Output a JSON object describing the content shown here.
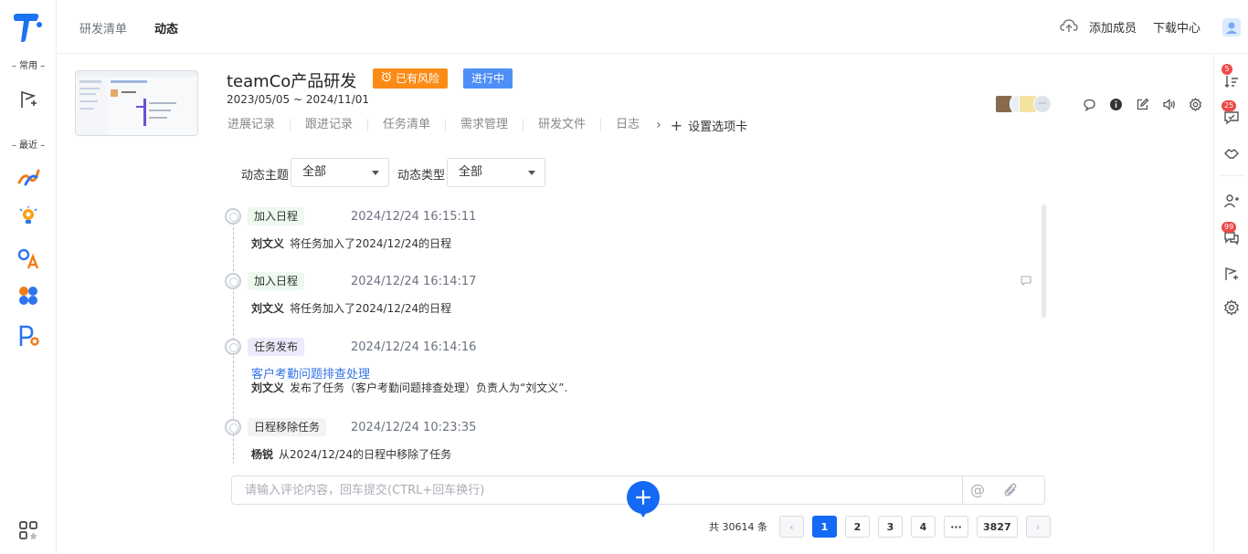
{
  "top_tabs": [
    {
      "label": "研发清单",
      "active": false
    },
    {
      "label": "动态",
      "active": true
    }
  ],
  "top_actions": {
    "add_member": "添加成员",
    "download_center": "下载中心"
  },
  "left_rail": {
    "common_label": "– 常用 –",
    "recent_label": "– 最近 –"
  },
  "right_rail": {
    "badges": [
      "5",
      "25",
      "99"
    ]
  },
  "project": {
    "title": "teamCo产品研发",
    "risk_label": "已有风险",
    "status_label": "进行中",
    "dates": "2023/05/05 ~ 2024/11/01",
    "tabs": [
      "进展记录",
      "跟进记录",
      "任务清单",
      "需求管理",
      "研发文件",
      "日志"
    ],
    "more_glyph": "›",
    "settings_tab": "设置选项卡",
    "member_more": "···"
  },
  "filters": {
    "topic_label": "动态主题",
    "topic_value": "全部",
    "type_label": "动态类型",
    "type_value": "全部"
  },
  "timeline": [
    {
      "tag": "加入日程",
      "tag_color": "green",
      "time": "2024/12/24 16:15:11",
      "user": "刘文义",
      "text": "将任务加入了2024/12/24的日程",
      "link": ""
    },
    {
      "tag": "加入日程",
      "tag_color": "green",
      "time": "2024/12/24 16:14:17",
      "user": "刘文义",
      "text": "将任务加入了2024/12/24的日程",
      "link": ""
    },
    {
      "tag": "任务发布",
      "tag_color": "purple",
      "time": "2024/12/24 16:14:16",
      "user": "刘文义",
      "text": "发布了任务（客户考勤问题排查处理）负责人为“刘文义”.",
      "link": "客户考勤问题排查处理"
    },
    {
      "tag": "日程移除任务",
      "tag_color": "grey",
      "time": "2024/12/24 10:23:35",
      "user": "杨锐",
      "text": "从2024/12/24的日程中移除了任务",
      "link": ""
    }
  ],
  "comment": {
    "placeholder": "请输入评论内容，回车提交(CTRL+回车换行)",
    "value": ""
  },
  "pagination": {
    "total": "共 30614 条",
    "pages": [
      "1",
      "2",
      "3",
      "4",
      "···",
      "3827"
    ],
    "current": "1",
    "prev": "‹",
    "next": "›"
  },
  "colors": {
    "primary": "#1469f5",
    "risk": "#fa8c16",
    "status": "#4f8ef7",
    "badge": "#f04848"
  }
}
